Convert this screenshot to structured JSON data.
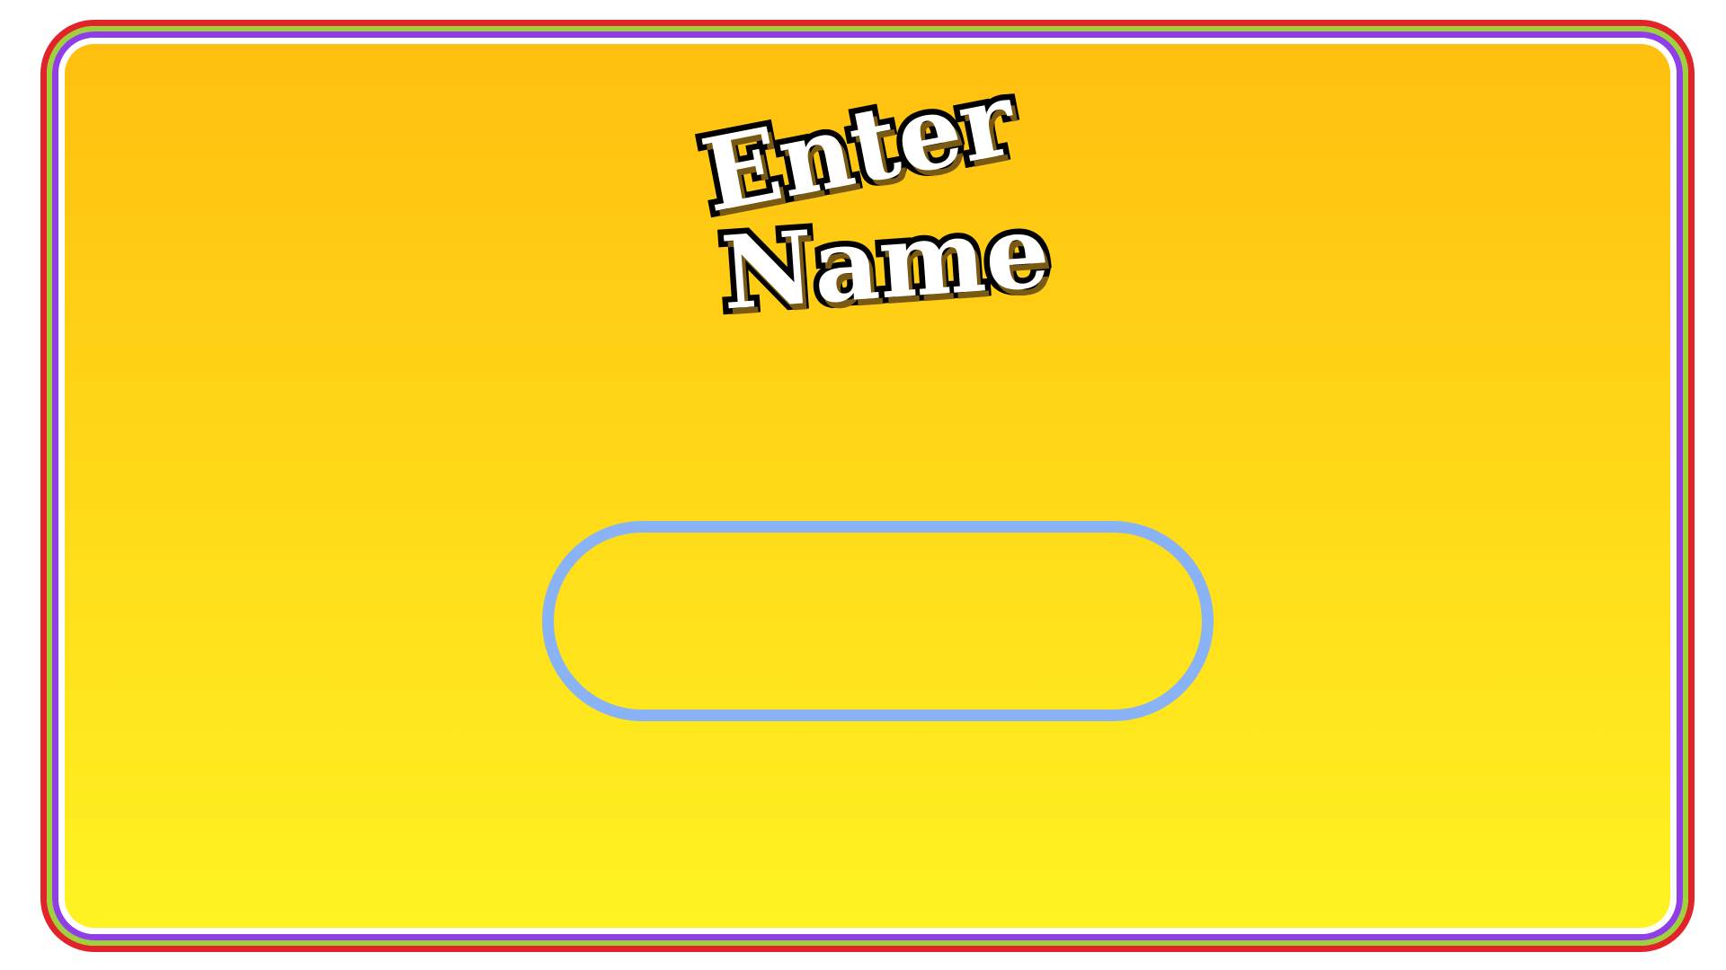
{
  "screen": {
    "title_line1": "Enter",
    "title_line2": "Name"
  },
  "name_input": {
    "value": "",
    "placeholder": ""
  },
  "colors": {
    "outer_border": "#e0242a",
    "green_border": "#9ed13a",
    "purple_border": "#8f3fe6",
    "panel_top": "#ffbf0f",
    "panel_bottom": "#fff322",
    "input_border": "#8ab3f5",
    "title_fill": "#ffffff",
    "title_outline": "#000000"
  }
}
